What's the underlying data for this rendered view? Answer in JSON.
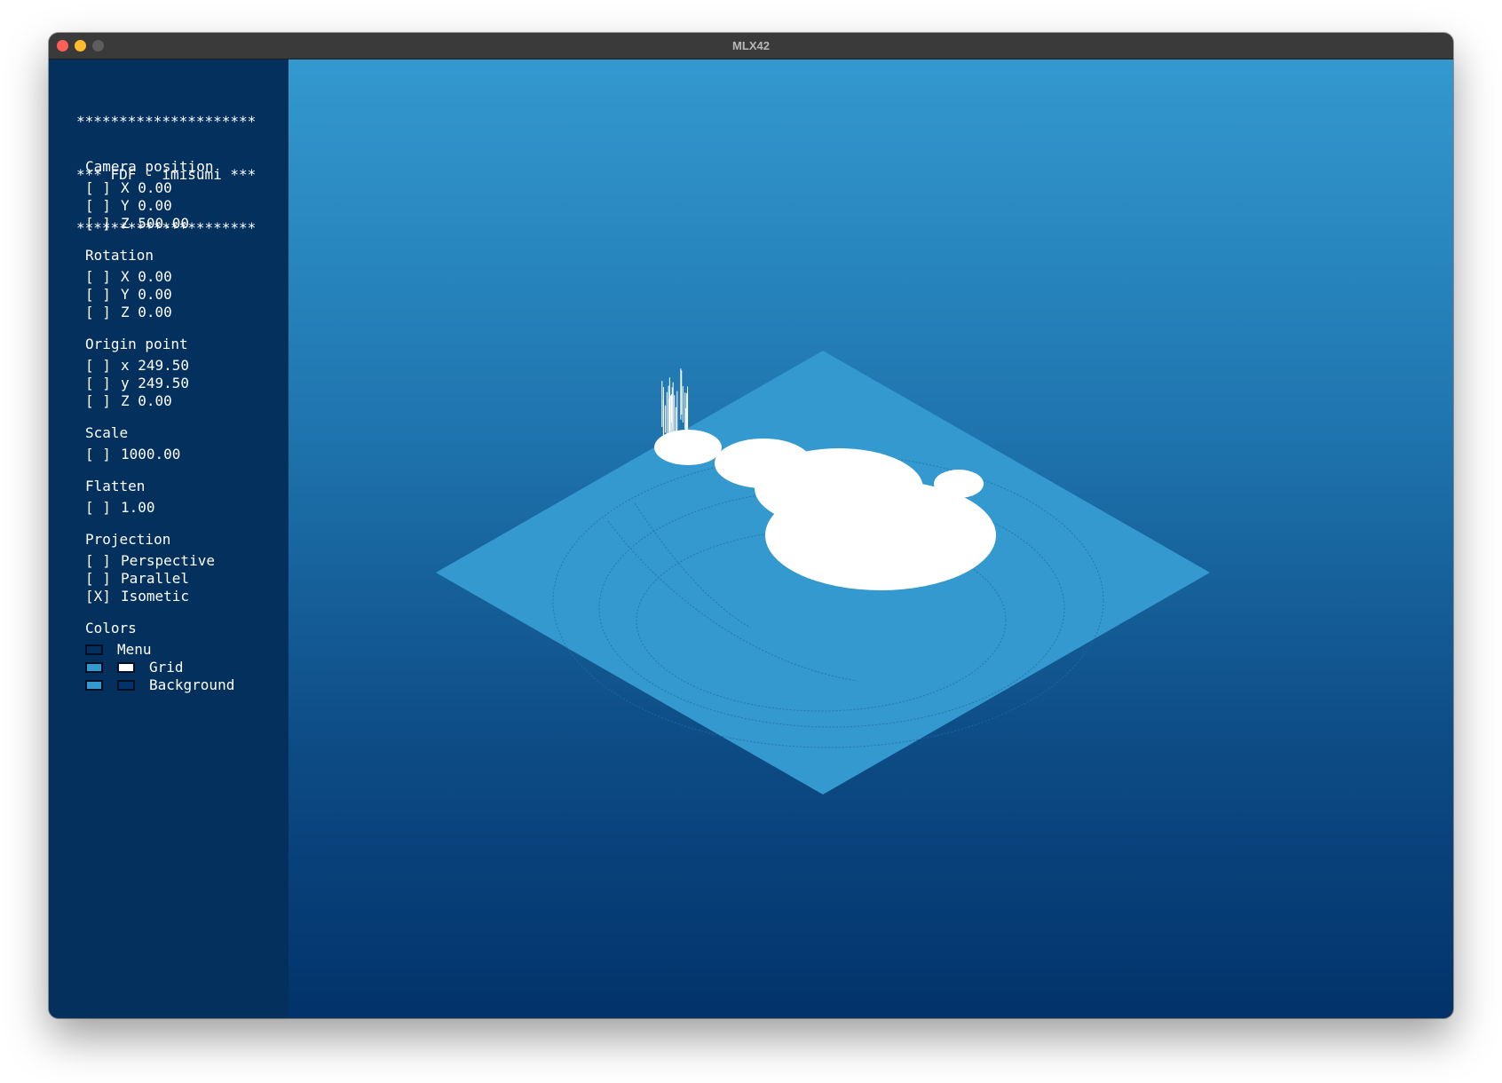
{
  "window": {
    "title": "MLX42"
  },
  "menu": {
    "banner": [
      "*********************",
      "*** FDF - imisumi ***",
      "*********************"
    ],
    "camera": {
      "title": "Camera position",
      "rows": [
        {
          "box": "[ ]",
          "text": "X 0.00"
        },
        {
          "box": "[ ]",
          "text": "Y 0.00"
        },
        {
          "box": "[ ]",
          "text": "Z 500.00"
        }
      ]
    },
    "rotation": {
      "title": "Rotation",
      "rows": [
        {
          "box": "[ ]",
          "text": "X 0.00"
        },
        {
          "box": "[ ]",
          "text": "Y 0.00"
        },
        {
          "box": "[ ]",
          "text": "Z 0.00"
        }
      ]
    },
    "origin": {
      "title": "Origin point",
      "rows": [
        {
          "box": "[ ]",
          "text": "x 249.50"
        },
        {
          "box": "[ ]",
          "text": "y 249.50"
        },
        {
          "box": "[ ]",
          "text": "Z 0.00"
        }
      ]
    },
    "scale": {
      "title": "Scale",
      "rows": [
        {
          "box": "[ ]",
          "text": "1000.00"
        }
      ]
    },
    "flatten": {
      "title": "Flatten",
      "rows": [
        {
          "box": "[ ]",
          "text": "1.00"
        }
      ]
    },
    "projection": {
      "title": "Projection",
      "rows": [
        {
          "box": "[ ]",
          "text": "Perspective",
          "checked": false
        },
        {
          "box": "[ ]",
          "text": "Parallel",
          "checked": false
        },
        {
          "box": "[X]",
          "text": "Isometic",
          "checked": true
        }
      ]
    },
    "colors": {
      "title": "Colors",
      "menu_label": "Menu",
      "grid_label": "Grid",
      "background_label": "Background",
      "menu_color": "#04305e",
      "grid_color_low": "#3399cf",
      "grid_color_high": "#ffffff",
      "background_color_top": "#3399cf",
      "background_color_bottom": "#02336a"
    }
  },
  "viewport": {
    "projection": "isometric",
    "plane_color": "#3399cf",
    "peak_color": "#ffffff"
  }
}
